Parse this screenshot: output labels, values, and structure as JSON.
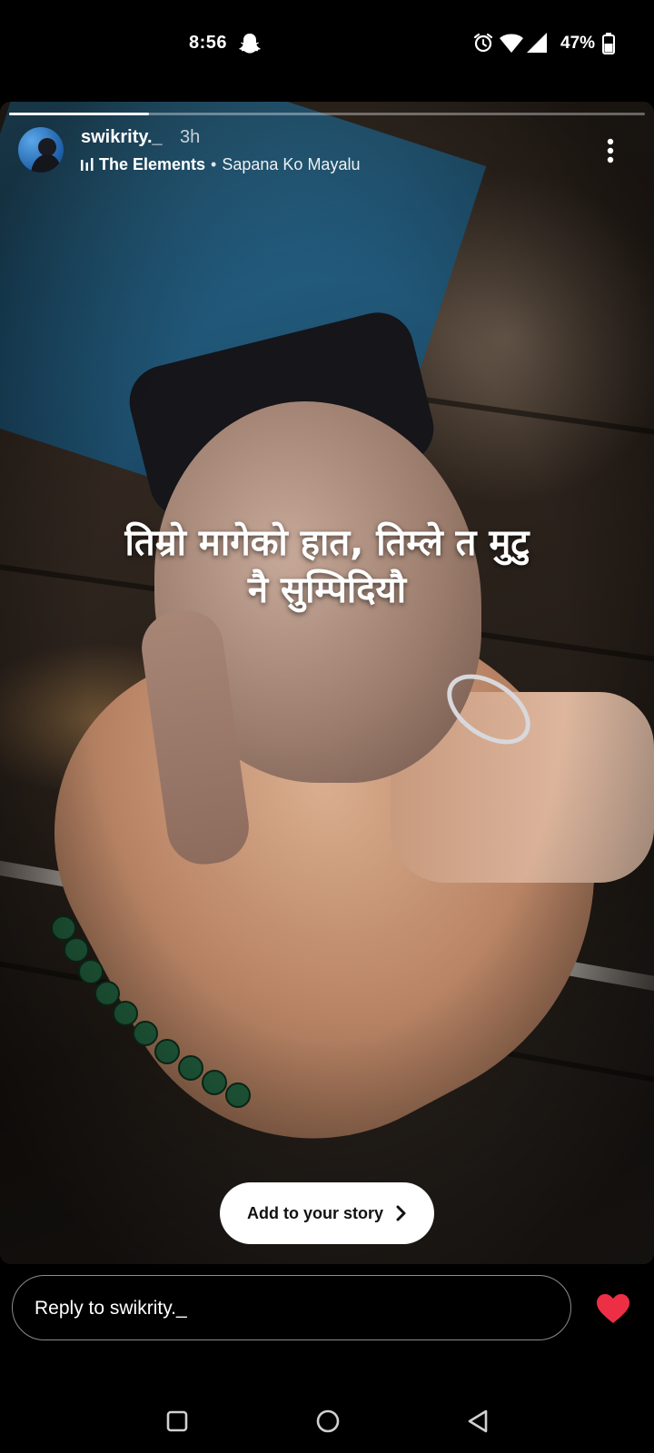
{
  "status_bar": {
    "time": "8:56",
    "battery": "47%",
    "icons": [
      "snapchat-ghost-icon",
      "alarm-icon",
      "wifi-icon",
      "signal-icon",
      "battery-icon"
    ]
  },
  "story": {
    "username": "swikrity._",
    "time_ago": "3h",
    "music": {
      "artist": "The Elements",
      "separator": "•",
      "song": "Sapana Ko Mayalu"
    },
    "progress": 0.22,
    "caption_line1": "तिम्रो मागेको हात, तिम्ले त मुटु",
    "caption_line2": "नै सुम्पिदियौ",
    "add_to_story_label": "Add to your story"
  },
  "reply": {
    "placeholder": "Reply to swikrity._"
  },
  "colors": {
    "heart": "#ed2f45",
    "background": "#000000"
  }
}
